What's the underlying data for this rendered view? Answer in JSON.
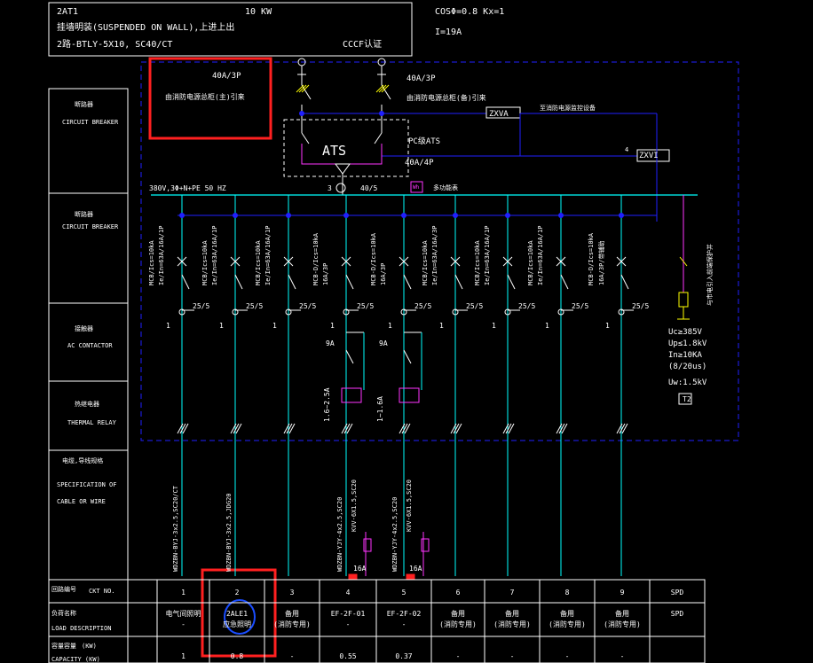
{
  "title_block": {
    "line1_left": "2AT1",
    "line1_right": "10 KW",
    "line2": "挂墙明装(SUSPENDED ON WALL),上进上出",
    "line3_left": "2路-BTLY-5X10, SC40/CT",
    "line3_right": "CCCF认证"
  },
  "params": {
    "cos": "COSΦ=0.8   Kx=1",
    "current": "I=19A"
  },
  "incoming": {
    "main_rating": "40A/3P",
    "main_label": "由消防电源总柜(主)引来",
    "backup_rating": "40A/3P",
    "backup_label": "由消防电源总柜(备)引来",
    "ats_label": "ATS",
    "ats_type": "PC级ATS",
    "ats_rating": "40A/4P",
    "zxva": "ZXVA",
    "zxvi": "ZXVI",
    "monitor_label": "至消防电源监控设备",
    "zxvi_num": "4",
    "bus_label": "380V,3Φ+N+PE 50 HZ",
    "meter_left": "3",
    "meter_right": "40/5",
    "multifunc_label": "多功能表",
    "wh": "Wh"
  },
  "side_labels": [
    {
      "cn": "断路器",
      "en": "CIRCUIT BREAKER"
    },
    {
      "cn": "断路器",
      "en": "CIRCUIT BREAKER"
    },
    {
      "cn": "接触器",
      "en": "AC CONTACTOR"
    },
    {
      "cn": "热继电器",
      "en": "THERMAL RELAY"
    },
    {
      "cn": "电缆,导线规格",
      "en1": "SPECIFICATION OF",
      "en2": "CABLE OR WIRE"
    }
  ],
  "breaker_labels": [
    {
      "a": "MCB/Ics=10kA",
      "b": "Ie/In=63A/16A/1P"
    },
    {
      "a": "MCB/Ics=10kA",
      "b": "Ie/In=63A/16A/1P"
    },
    {
      "a": "MCB/Ics=10kA",
      "b": "Ie/In=63A/16A/1P"
    },
    {
      "a": "MCB-D/Ics=10kA",
      "b": "16A/3P"
    },
    {
      "a": "MCB-D/Ics=10kA",
      "b": "16A/3P"
    },
    {
      "a": "MCB/Ics=10kA",
      "b": "Ie/In=63A/16A/3P"
    },
    {
      "a": "MCB/Ics=10kA",
      "b": "Ie/In=63A/16A/1P"
    },
    {
      "a": "MCB/Ics=10kA",
      "b": "Ie/In=63A/16A/1P"
    },
    {
      "a": "MCB-D/Ics=10kA",
      "b": "16A/3P/带辅助"
    }
  ],
  "ct_label": "25/5",
  "ct_phase": "1",
  "contactor_ratings": [
    "9A",
    "9A"
  ],
  "relay_ratings": [
    "1.6~2.5A",
    "1~1.6A"
  ],
  "spd": {
    "uc": "Uc≥385V",
    "up": "Up≤1.8kV",
    "in": "In≥10KA",
    "wave": "(8/20us)",
    "uw": "Uw:1.5kV",
    "box": "T2",
    "note": "与市电引入前端保护并"
  },
  "cables": [
    "WDZBN-BYJ-3x2.5,SC20/CT",
    "WDZBN-BYJ-3x2.5,JDG20",
    "WDZBN-YJY-4x2.5,SC20",
    "KVV-6X1.5,SC20",
    "WDZBN-YJY-4x2.5,SC20",
    "KVV-6X1.5,SC20"
  ],
  "fuse_ratings": [
    "16A",
    "16A"
  ],
  "table": {
    "row_labels": [
      {
        "cn": "回路编号",
        "en": "CKT NO."
      },
      {
        "cn": "负荷名称",
        "en": "LOAD DESCRIPTION"
      },
      {
        "cn": "容量容量",
        "unit": "(KW)",
        "en": "CAPACITY (KW)"
      }
    ],
    "ckt_no": [
      "1",
      "2",
      "3",
      "4",
      "5",
      "6",
      "7",
      "8",
      "9",
      "SPD"
    ],
    "desc_top": [
      "电气间照明",
      "2ALE1",
      "备用",
      "EF-2F-01",
      "EF-2F-02",
      "备用",
      "备用",
      "备用",
      "备用",
      "SPD"
    ],
    "desc_bottom": [
      "-",
      "应急照明",
      "(消防专用)",
      "-",
      "-",
      "(消防专用)",
      "(消防专用)",
      "(消防专用)",
      "(消防专用)",
      ""
    ],
    "capacity": [
      "1",
      "0.8",
      "-",
      "0.55",
      "0.37",
      "-",
      "-",
      "-",
      "-",
      ""
    ]
  },
  "colors": {
    "bus": "#00ffff",
    "dash": "#2020ff",
    "magenta": "#ff33ff",
    "yellow": "#ffff00",
    "highlight": "#ff2020",
    "circle": "#1a4dff",
    "green": "#33ff66"
  }
}
